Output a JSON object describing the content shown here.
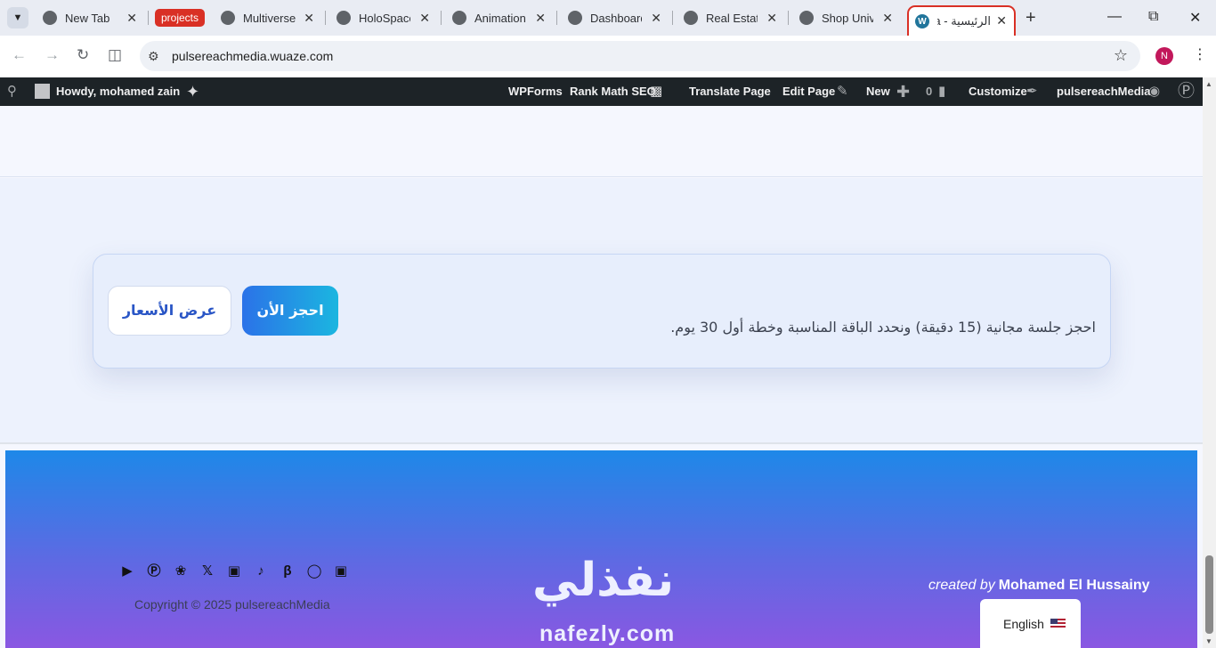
{
  "browser": {
    "tabs": [
      {
        "title": "New Tab"
      },
      {
        "title": "Multiverse"
      },
      {
        "title": "HoloSpace"
      },
      {
        "title": "Animation"
      },
      {
        "title": "Dashboard"
      },
      {
        "title": "Real Estate"
      },
      {
        "title": "Shop Unive"
      },
      {
        "title": "الرئيسية - a"
      }
    ],
    "tab_group_label": "projects",
    "close_glyph": "✕",
    "new_tab_glyph": "+",
    "profile_initial": "N",
    "url": "pulsereachmedia.wuaze.com"
  },
  "admin_bar": {
    "greeting": "Howdy, mohamed zain",
    "wpforms": "WPForms",
    "rank_math": "Rank Math SEO",
    "translate": "Translate Page",
    "edit_page": "Edit Page",
    "new": "New",
    "comments_count": "0",
    "customize": "Customize",
    "site_name": "pulsereachMedia"
  },
  "cta": {
    "text": "احجز جلسة مجانية (15 دقيقة) ونحدد الباقة المناسبة وخطة أول 30 يوم.",
    "book_label": "احجز الأن",
    "prices_label": "عرض الأسعار"
  },
  "footer": {
    "social_icons": [
      "youtube-icon",
      "wordpress-icon",
      "bluesky-icon",
      "x-icon",
      "linkedin-icon",
      "tiktok-icon",
      "behance-icon",
      "instagram-icon",
      "facebook-icon"
    ],
    "copyright": "Copyright © 2025 pulsereachMedia",
    "logo_arabic": "نفذلي",
    "logo_latin": "nafezly.com",
    "created_by_prefix": "created by",
    "created_by_name": "Mohamed El Hussainy",
    "language": "English"
  }
}
